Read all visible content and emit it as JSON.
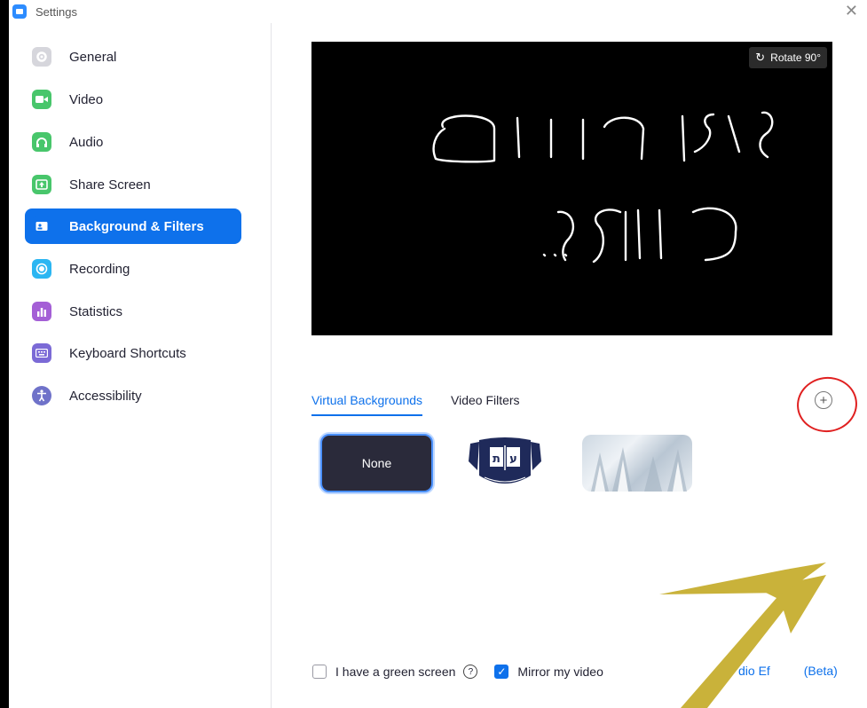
{
  "window": {
    "title": "Settings",
    "close_icon": "close-icon"
  },
  "sidebar": {
    "items": [
      {
        "label": "General",
        "icon": "gear-icon",
        "color": "#d6d6dc",
        "active": false
      },
      {
        "label": "Video",
        "icon": "video-camera-icon",
        "color": "#48c66b",
        "active": false
      },
      {
        "label": "Audio",
        "icon": "headphones-icon",
        "color": "#48c66b",
        "active": false
      },
      {
        "label": "Share Screen",
        "icon": "share-screen-icon",
        "color": "#48c66b",
        "active": false
      },
      {
        "label": "Background & Filters",
        "icon": "background-icon",
        "color": "#0e71eb",
        "active": true
      },
      {
        "label": "Recording",
        "icon": "record-icon",
        "color": "#2bb6f2",
        "active": false
      },
      {
        "label": "Statistics",
        "icon": "statistics-icon",
        "color": "#a45fd6",
        "active": false
      },
      {
        "label": "Keyboard Shortcuts",
        "icon": "keyboard-icon",
        "color": "#7b6ad6",
        "active": false
      },
      {
        "label": "Accessibility",
        "icon": "accessibility-icon",
        "color": "#6f72c9",
        "active": false
      }
    ]
  },
  "preview": {
    "rotate_label": "Rotate 90°",
    "handwriting_line1": "כאן רואים",
    "handwriting_line2": "אותי?..."
  },
  "tabs": [
    {
      "label": "Virtual Backgrounds",
      "active": true
    },
    {
      "label": "Video Filters",
      "active": false
    }
  ],
  "backgrounds": [
    {
      "label": "None",
      "selected": true
    },
    {
      "label": "",
      "kind": "emblem",
      "emblem_letters": "ת | ע"
    },
    {
      "label": "",
      "kind": "snowy-forest"
    }
  ],
  "bottom": {
    "green_screen_label": "I have a green screen",
    "green_screen_checked": false,
    "mirror_label": "Mirror my video",
    "mirror_checked": true,
    "studio_effects_label": "dio Ef",
    "studio_effects_suffix": "(Beta)"
  },
  "colors": {
    "accent": "#0e71eb",
    "annotation_red": "#e02020",
    "annotation_yellow": "#c9b23a"
  }
}
